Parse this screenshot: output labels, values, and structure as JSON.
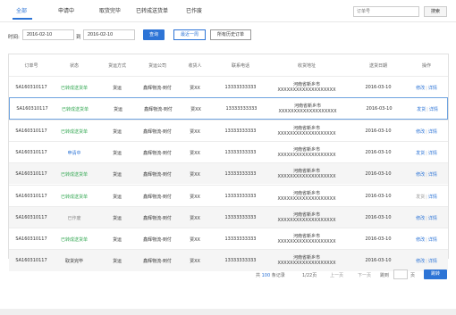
{
  "tabs": [
    {
      "label": "全部",
      "active": true
    },
    {
      "label": "申请中",
      "active": false
    },
    {
      "label": "取货完毕",
      "active": false
    },
    {
      "label": "已转成送货单",
      "active": false
    },
    {
      "label": "已作废",
      "active": false
    }
  ],
  "search": {
    "placeholder": "订单号",
    "button": "搜索"
  },
  "filter": {
    "time_label": "时间:",
    "from": "2016-02-10",
    "to_label": "到",
    "to": "2016-02-10",
    "query_button": "查询",
    "week_button": "最近一周",
    "history_button": "所有历史订单"
  },
  "table": {
    "headers": [
      "订单号",
      "状态",
      "货运方式",
      "货运公司",
      "收货人",
      "联系电话",
      "收货地址",
      "送货日期",
      "操作"
    ],
    "rows": [
      {
        "order": "SA160310117",
        "status": "已转成送货单",
        "status_color": "green",
        "method": "货运",
        "company": "鑫辉物流-到付",
        "receiver": "贾XX",
        "phone": "13333333333",
        "addr1": "河南省新乡市",
        "addr2": "XXXXXXXXXXXXXXXXXXX",
        "date": "2016-03-10",
        "op1": "修改",
        "op2": "详情",
        "op1_disabled": false,
        "alt": false,
        "selected": false
      },
      {
        "order": "SA160310117",
        "status": "已转成送货单",
        "status_color": "green",
        "method": "货运",
        "company": "鑫辉物流-到付",
        "receiver": "贾XX",
        "phone": "13333333333",
        "addr1": "河南省新乡市",
        "addr2": "XXXXXXXXXXXXXXXXXXX",
        "date": "2016-03-10",
        "op1": "发货",
        "op2": "详情",
        "op1_disabled": false,
        "alt": false,
        "selected": true
      },
      {
        "order": "SA160310117",
        "status": "已转成送货单",
        "status_color": "green",
        "method": "货运",
        "company": "鑫辉物流-到付",
        "receiver": "贾XX",
        "phone": "13333333333",
        "addr1": "河南省新乡市",
        "addr2": "XXXXXXXXXXXXXXXXXXX",
        "date": "2016-03-10",
        "op1": "修改",
        "op2": "详情",
        "op1_disabled": false,
        "alt": false,
        "selected": false
      },
      {
        "order": "SA160310117",
        "status": "申请中",
        "status_color": "blue",
        "method": "货运",
        "company": "鑫辉物流-到付",
        "receiver": "贾XX",
        "phone": "13333333333",
        "addr1": "河南省新乡市",
        "addr2": "XXXXXXXXXXXXXXXXXXX",
        "date": "2016-03-10",
        "op1": "发货",
        "op2": "详情",
        "op1_disabled": false,
        "alt": false,
        "selected": false
      },
      {
        "order": "SA160310117",
        "status": "已转成送货单",
        "status_color": "green",
        "method": "货运",
        "company": "鑫辉物流-到付",
        "receiver": "贾XX",
        "phone": "13333333333",
        "addr1": "河南省新乡市",
        "addr2": "XXXXXXXXXXXXXXXXXXX",
        "date": "2016-03-10",
        "op1": "修改",
        "op2": "详情",
        "op1_disabled": false,
        "alt": true,
        "selected": false
      },
      {
        "order": "SA160310117",
        "status": "已转成送货单",
        "status_color": "green",
        "method": "货运",
        "company": "鑫辉物流-到付",
        "receiver": "贾XX",
        "phone": "13333333333",
        "addr1": "河南省新乡市",
        "addr2": "XXXXXXXXXXXXXXXXXXX",
        "date": "2016-03-10",
        "op1": "发货",
        "op2": "详情",
        "op1_disabled": true,
        "alt": false,
        "selected": false
      },
      {
        "order": "SA160310117",
        "status": "已作废",
        "status_color": "gray",
        "method": "货运",
        "company": "鑫辉物流-到付",
        "receiver": "贾XX",
        "phone": "13333333333",
        "addr1": "河南省新乡市",
        "addr2": "XXXXXXXXXXXXXXXXXXX",
        "date": "2016-03-10",
        "op1": "修改",
        "op2": "详情",
        "op1_disabled": false,
        "alt": true,
        "selected": false
      },
      {
        "order": "SA160310117",
        "status": "已转成送货单",
        "status_color": "green",
        "method": "货运",
        "company": "鑫辉物流-到付",
        "receiver": "贾XX",
        "phone": "13333333333",
        "addr1": "河南省新乡市",
        "addr2": "XXXXXXXXXXXXXXXXXXX",
        "date": "2016-03-10",
        "op1": "修改",
        "op2": "详情",
        "op1_disabled": false,
        "alt": false,
        "selected": false
      },
      {
        "order": "SA160310117",
        "status": "取货完毕",
        "status_color": "dark",
        "method": "货运",
        "company": "鑫辉物流-到付",
        "receiver": "贾XX",
        "phone": "13333333333",
        "addr1": "河南省新乡市",
        "addr2": "XXXXXXXXXXXXXXXXXXX",
        "date": "2016-03-10",
        "op1": "修改",
        "op2": "详情",
        "op1_disabled": false,
        "alt": true,
        "selected": false
      }
    ]
  },
  "pagination": {
    "total_prefix": "共",
    "total": "100",
    "total_suffix": "条记录",
    "pages": "1/22页",
    "prev": "上一页",
    "next": "下一页",
    "goto_label": "跳到",
    "page_unit": "页",
    "jump_button": "跳转"
  },
  "colors": {
    "accent": "#2d74d6",
    "green": "#34a853",
    "gray": "#888888"
  }
}
